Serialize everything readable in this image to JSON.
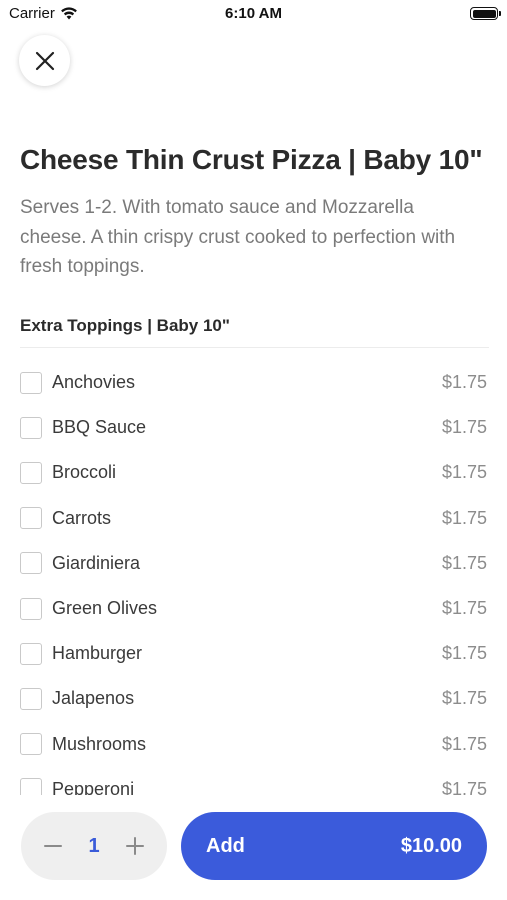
{
  "status_bar": {
    "carrier": "Carrier",
    "time": "6:10 AM"
  },
  "item": {
    "title": "Cheese Thin Crust Pizza | Baby 10\"",
    "description": "Serves 1-2. With tomato sauce and Mozzarella cheese. A thin crispy crust cooked to perfection with fresh toppings."
  },
  "section": {
    "title": "Extra Toppings | Baby 10\""
  },
  "toppings": [
    {
      "name": "Anchovies",
      "price": "$1.75"
    },
    {
      "name": "BBQ Sauce",
      "price": "$1.75"
    },
    {
      "name": "Broccoli",
      "price": "$1.75"
    },
    {
      "name": "Carrots",
      "price": "$1.75"
    },
    {
      "name": "Giardiniera",
      "price": "$1.75"
    },
    {
      "name": "Green Olives",
      "price": "$1.75"
    },
    {
      "name": "Hamburger",
      "price": "$1.75"
    },
    {
      "name": "Jalapenos",
      "price": "$1.75"
    },
    {
      "name": "Mushrooms",
      "price": "$1.75"
    },
    {
      "name": "Pepperoni",
      "price": "$1.75"
    }
  ],
  "footer": {
    "quantity": "1",
    "add_label": "Add",
    "total": "$10.00"
  },
  "colors": {
    "accent": "#3b5bdb",
    "quantity": "#3a5bd9"
  },
  "icons": {
    "close": "close-icon",
    "minus": "minus-icon",
    "plus": "plus-icon",
    "wifi": "wifi-icon",
    "battery": "battery-icon"
  }
}
